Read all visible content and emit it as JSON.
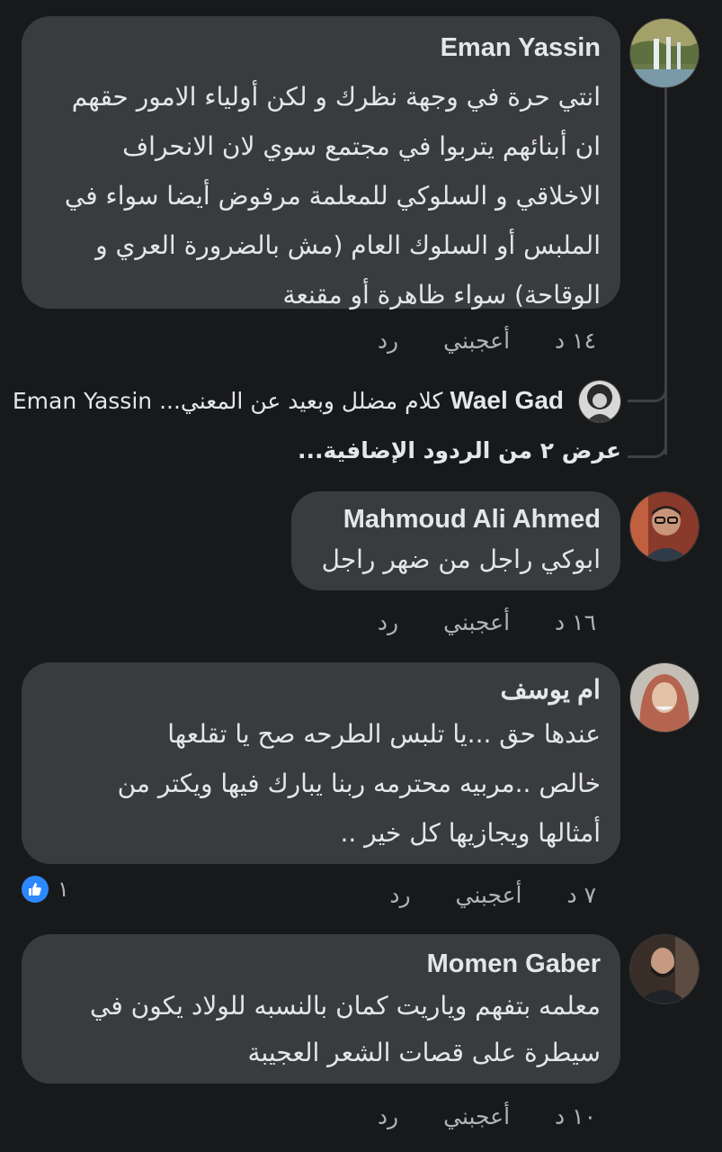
{
  "comments": [
    {
      "author": "Eman Yassin",
      "text": "انتي حرة في وجهة نظرك و لكن أولياء الامور حقهم\nان أبنائهم يتربوا في مجتمع سوي لان الانحراف\nالاخلاقي و السلوكي للمعلمة مرفوض أيضا سواء في\nالملبس أو السلوك العام (مش بالضرورة العري و\nالوقاحة) سواء ظاهرة أو مقنعة",
      "time": "١٤ د",
      "like_label": "أعجبني",
      "reply_label": "رد",
      "avatar_icon": "waterfall-avatar-icon"
    },
    {
      "author": "Mahmoud Ali Ahmed",
      "text": "ابوكي راجل من ضهر راجل",
      "time": "١٦ د",
      "like_label": "أعجبني",
      "reply_label": "رد",
      "avatar_icon": "man-glasses-avatar-icon"
    },
    {
      "author": "ام يوسف",
      "text": "عندها حق ...يا تلبس الطرحه صح يا تقلعها\nخالص ..مربيه محترمه ربنا يبارك فيها ويكتر من\nأمثالها ويجازيها كل خير ..",
      "time": "٧ د",
      "like_label": "أعجبني",
      "reply_label": "رد",
      "reaction_count": "١",
      "reaction_icon": "like-thumb-icon",
      "avatar_icon": "woman-hijab-avatar-icon"
    },
    {
      "author": "Momen Gaber",
      "text": "معلمه بتفهم وياريت كمان بالنسبه للولاد يكون في\nسيطرة على قصات الشعر العجيبة",
      "time": "١٠ د",
      "like_label": "أعجبني",
      "reply_label": "رد",
      "avatar_icon": "man-beard-avatar-icon"
    }
  ],
  "reply_preview": {
    "author": "Wael Gad",
    "text": "كلام مضلل وبعيد عن المعني... Eman Yassin",
    "avatar_icon": "illustrated-portrait-avatar-icon"
  },
  "more_replies_label": "عرض ٢ من الردود الإضافية...",
  "colors": {
    "background": "#18191a",
    "bubble": "#3a3b3c",
    "text_primary": "#e4e6eb",
    "text_secondary": "#b0b3b8",
    "like_blue": "#2d88ff"
  }
}
